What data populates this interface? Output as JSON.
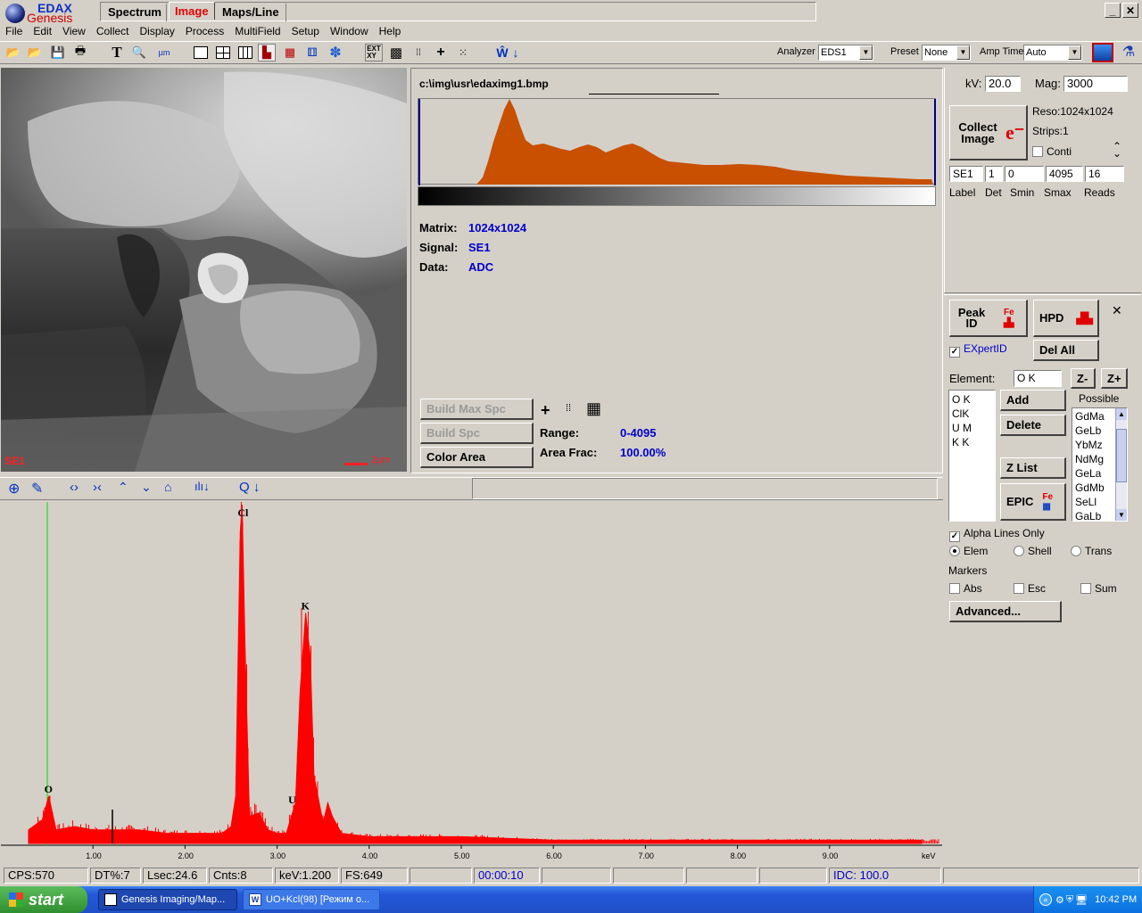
{
  "brand": {
    "line1": "EDAX",
    "line2": "Genesis"
  },
  "mode_tabs": [
    "Spectrum",
    "Image",
    "Maps/Line"
  ],
  "menu": [
    "File",
    "Edit",
    "View",
    "Collect",
    "Display",
    "Process",
    "MultiField",
    "Setup",
    "Window",
    "Help"
  ],
  "toolbar": {
    "analyzer_label": "Analyzer",
    "analyzer_value": "EDS1",
    "preset_label": "Preset",
    "preset_value": "None",
    "amp_label": "Amp Time",
    "amp_value": "Auto"
  },
  "image_panel": {
    "signal_label": "SE1",
    "scale_label": "2μm"
  },
  "info": {
    "path": "c:\\img\\usr\\edaximg1.bmp",
    "matrix_label": "Matrix:",
    "matrix": "1024x1024",
    "signal_label": "Signal:",
    "signal": "SE1",
    "data_label": "Data:",
    "data": "ADC",
    "build_max": "Build Max Spc",
    "build_spc": "Build Spc",
    "color_area": "Color Area",
    "range_label": "Range:",
    "range": "0-4095",
    "area_label": "Area Frac:",
    "area": "100.00%"
  },
  "collect": {
    "kv_label": "kV:",
    "kv": "20.0",
    "mag_label": "Mag:",
    "mag": "3000",
    "button": "Collect Image",
    "reso": "Reso:1024x1024",
    "strips": "Strips:1",
    "conti": "Conti",
    "fields": {
      "label": "SE1",
      "det": "1",
      "smin": "0",
      "smax": "4095",
      "reads": "16"
    },
    "headers": [
      "Label",
      "Det",
      "Smin",
      "Smax",
      "Reads"
    ]
  },
  "peak": {
    "peak_id": "Peak ID",
    "hpd": "HPD",
    "expert": "EXpertID",
    "del_all": "Del All",
    "element_label": "Element:",
    "element_value": "O K",
    "zminus": "Z-",
    "zplus": "Z+",
    "list": [
      "O K",
      "ClK",
      "U M",
      "K K"
    ],
    "add": "Add",
    "delete": "Delete",
    "zlist": "Z List",
    "epic": "EPIC",
    "possible_label": "Possible",
    "possible": [
      "GdMa",
      "GeLb",
      "YbMz",
      "NdMg",
      "GeLa",
      "GdMb",
      "SeLl",
      "GaLb"
    ],
    "alpha": "Alpha Lines Only",
    "elem": "Elem",
    "shell": "Shell",
    "trans": "Trans",
    "markers": "Markers",
    "abs": "Abs",
    "esc": "Esc",
    "sum": "Sum",
    "advanced": "Advanced..."
  },
  "chart_data": {
    "type": "line",
    "xlabel": "keV",
    "xlim": [
      0,
      10.3
    ],
    "x_ticks": [
      "1.00",
      "2.00",
      "3.00",
      "4.00",
      "5.00",
      "6.00",
      "7.00",
      "8.00",
      "9.00"
    ],
    "x": [
      0.3,
      0.45,
      0.52,
      0.6,
      0.8,
      1.0,
      1.2,
      1.5,
      1.8,
      2.0,
      2.2,
      2.4,
      2.5,
      2.55,
      2.6,
      2.62,
      2.65,
      2.7,
      2.8,
      2.9,
      3.0,
      3.1,
      3.2,
      3.25,
      3.31,
      3.36,
      3.4,
      3.5,
      3.55,
      3.6,
      3.7,
      4.0,
      5.0,
      6.0,
      7.0,
      8.0,
      9.0,
      10.0
    ],
    "y": [
      4,
      7,
      14,
      4,
      5,
      4,
      4,
      4,
      3,
      3,
      3,
      3,
      5,
      14,
      92,
      100,
      60,
      8,
      9,
      4,
      3,
      3,
      12,
      45,
      68,
      55,
      20,
      6,
      12,
      8,
      3,
      2,
      2,
      1,
      1,
      1,
      1,
      1
    ],
    "peaks": [
      {
        "label": "O",
        "x": 0.52
      },
      {
        "label": "Cl",
        "x": 2.62
      },
      {
        "label": "K",
        "x": 3.31
      },
      {
        "label": "U",
        "x": 3.17
      }
    ],
    "series_color": "#ff0000"
  },
  "status": {
    "cps": "CPS:570",
    "dt": "DT%:7",
    "lsec": "Lsec:24.6",
    "cnts": "Cnts:8",
    "kev": "keV:1.200",
    "fs": "FS:649",
    "time": "00:00:10",
    "idc": "IDC: 100.0"
  },
  "taskbar": {
    "start": "start",
    "task1": "Genesis Imaging/Map...",
    "task2": "UO+Kcl(98) [Режим о...",
    "clock": "10:42 PM"
  }
}
